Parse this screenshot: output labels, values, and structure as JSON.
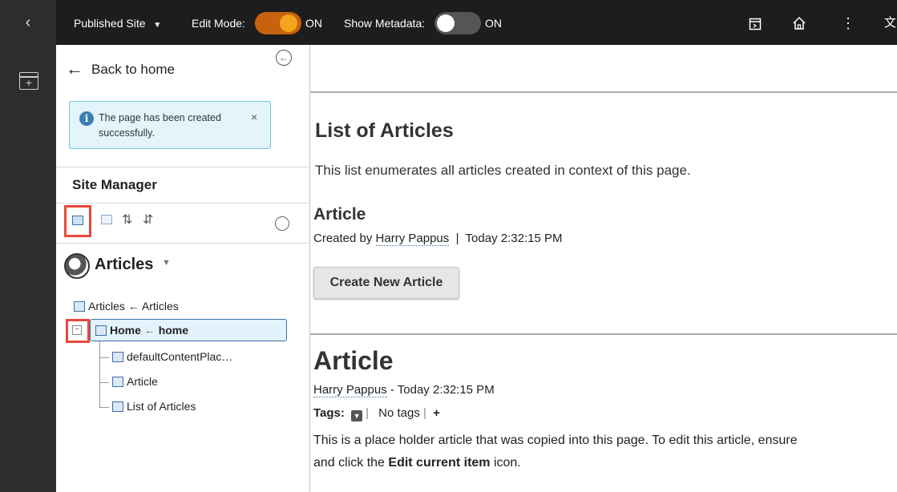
{
  "rail": {
    "back_glyph": "‹",
    "add_icon": "+"
  },
  "topbar": {
    "site_label": "Published Site",
    "site_caret": "▼",
    "edit_mode_label": "Edit Mode:",
    "edit_mode_state": "ON",
    "show_metadata_label": "Show Metadata:",
    "show_metadata_state": "ON",
    "icons": [
      "drawer-icon",
      "home-icon",
      "more-icon",
      "language-icon"
    ],
    "lang_glyph": "文",
    "more_glyph": "⋮"
  },
  "panel": {
    "back_label": "Back to home",
    "notice": {
      "text": "The page has been created successfully.",
      "close": "×"
    },
    "title": "Site Manager",
    "site_area": "Articles",
    "tree": {
      "root": "Articles ← Articles",
      "home_name": "Home",
      "home_sep": " ← ",
      "home_alias": "home",
      "children": [
        "defaultContentPlac…",
        "Article",
        "List of Articles"
      ]
    }
  },
  "main": {
    "list_title": "List of Articles",
    "list_description": "This list enumerates all articles created in context of this page.",
    "item_title": "Article",
    "item_meta_prefix": "Created by ",
    "item_author": "Harry Pappus",
    "item_meta_suffix": "  |  Today 2:32:15 PM",
    "create_button": "Create New Article",
    "article": {
      "title": "Article",
      "author": "Harry Pappus",
      "date": " - Today 2:32:15 PM",
      "tags_label": "Tags:",
      "tags_value": " No tags ",
      "tags_sep": "|",
      "tags_add": "+",
      "body_line1": "This is a place holder article that was copied into this page. To edit this article, ensure",
      "body_line2_prefix": "and click the ",
      "body_line2_bold": "Edit current item",
      "body_line2_suffix": " icon."
    }
  },
  "colors": {
    "accent_orange": "#f2a51d",
    "highlight_red": "#e8483c",
    "notice_bg": "#e3f5fb",
    "selection_border": "#3a6fa8"
  }
}
